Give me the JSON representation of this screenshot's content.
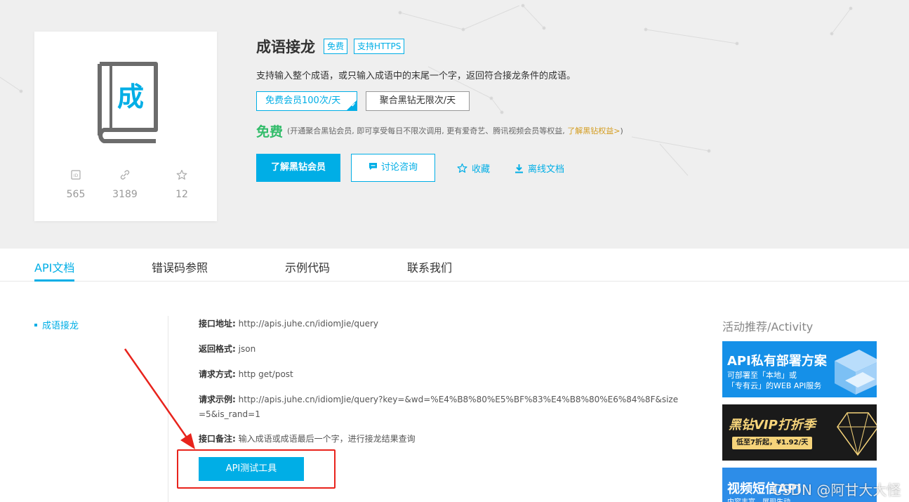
{
  "api": {
    "name": "成语接龙",
    "tags": [
      "免费",
      "支持HTTPS"
    ],
    "description": "支持输入整个成语，或只输入成语中的末尾一个字，返回符合接龙条件的成语。",
    "logo_char": "成",
    "stats": [
      {
        "icon": "id-icon",
        "value": "565"
      },
      {
        "icon": "link-icon",
        "value": "3189"
      },
      {
        "icon": "star-icon",
        "value": "12"
      }
    ],
    "plans": [
      "免费会员100次/天",
      "聚合黑钻无限次/天"
    ],
    "price": "免费",
    "price_note_prefix": "(开通聚合黑钻会员, 即可享受每日不限次调用, 更有爱奇艺、腾讯视频会员等权益,",
    "price_note_link": "了解黑钻权益>",
    "price_note_suffix": ")"
  },
  "actions": {
    "primary": "了解黑钻会员",
    "consult": "讨论咨询",
    "favorite": "收藏",
    "download": "离线文档"
  },
  "tabs": [
    "API文档",
    "错误码参照",
    "示例代码",
    "联系我们"
  ],
  "sidebar": {
    "item": "成语接龙"
  },
  "doc": {
    "rows": [
      {
        "label": "接口地址:",
        "value": "http://apis.juhe.cn/idiomJie/query"
      },
      {
        "label": "返回格式:",
        "value": "json"
      },
      {
        "label": "请求方式:",
        "value": "http get/post"
      },
      {
        "label": "请求示例:",
        "value": "http://apis.juhe.cn/idiomJie/query?key=&wd=%E4%B8%80%E5%BF%83%E4%B8%80%E6%84%8F&size=5&is_rand=1"
      },
      {
        "label": "接口备注:",
        "value": "输入成语或成语最后一个字，进行接龙结果查询"
      }
    ],
    "test_button": "API测试工具"
  },
  "activity": {
    "title": "活动推荐/Activity",
    "banners": [
      {
        "title": "API私有部署方案",
        "line1": "可部署至「本地」或",
        "line2": "「专有云」的WEB API服务"
      },
      {
        "title": "黑钻VIP打折季",
        "pill": "低至7折起，¥1.92/天"
      },
      {
        "title": "视频短信API",
        "line1": "内容丰富，展现生动"
      }
    ]
  },
  "watermark": "CSDN @阿甘大大怪",
  "colors": {
    "accent": "#00aee6",
    "price": "#32bc6a",
    "gold": "#d39b1c",
    "annotation": "#e8231c"
  }
}
